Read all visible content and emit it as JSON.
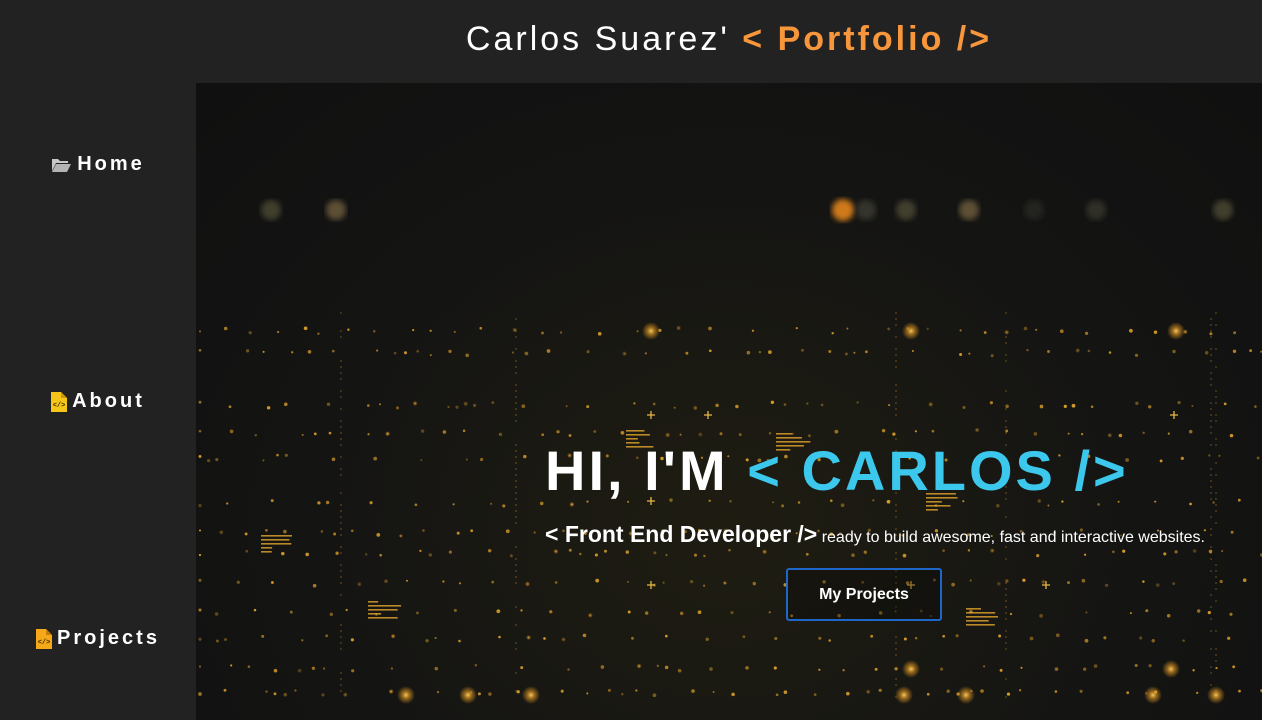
{
  "header": {
    "title_prefix": "Carlos Suarez'",
    "title_accent": "< Portfolio />"
  },
  "sidebar": {
    "items": [
      {
        "label": "Home",
        "icon": "folder-open-icon"
      },
      {
        "label": "About",
        "icon": "code-file-icon"
      },
      {
        "label": "Projects",
        "icon": "code-file-icon"
      }
    ]
  },
  "hero": {
    "greeting": "HI, I'M",
    "name": "< CARLOS />",
    "role": "< Front End Developer />",
    "tagline": "ready to build awesome, fast and interactive websites.",
    "cta_label": "My Projects"
  },
  "colors": {
    "background": "#222222",
    "accent_orange": "#f7963b",
    "accent_cyan": "#3cc8ec",
    "button_border": "#1e67c8",
    "icon_yellow": "#f5c518"
  }
}
